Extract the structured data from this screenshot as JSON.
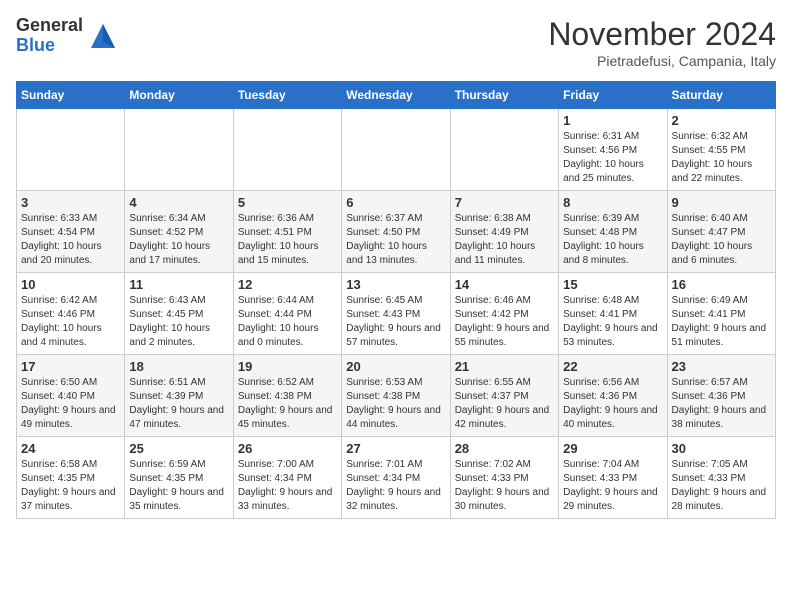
{
  "logo": {
    "general": "General",
    "blue": "Blue"
  },
  "title": "November 2024",
  "location": "Pietradefusi, Campania, Italy",
  "days_of_week": [
    "Sunday",
    "Monday",
    "Tuesday",
    "Wednesday",
    "Thursday",
    "Friday",
    "Saturday"
  ],
  "weeks": [
    [
      {
        "day": "",
        "info": ""
      },
      {
        "day": "",
        "info": ""
      },
      {
        "day": "",
        "info": ""
      },
      {
        "day": "",
        "info": ""
      },
      {
        "day": "",
        "info": ""
      },
      {
        "day": "1",
        "info": "Sunrise: 6:31 AM\nSunset: 4:56 PM\nDaylight: 10 hours and 25 minutes."
      },
      {
        "day": "2",
        "info": "Sunrise: 6:32 AM\nSunset: 4:55 PM\nDaylight: 10 hours and 22 minutes."
      }
    ],
    [
      {
        "day": "3",
        "info": "Sunrise: 6:33 AM\nSunset: 4:54 PM\nDaylight: 10 hours and 20 minutes."
      },
      {
        "day": "4",
        "info": "Sunrise: 6:34 AM\nSunset: 4:52 PM\nDaylight: 10 hours and 17 minutes."
      },
      {
        "day": "5",
        "info": "Sunrise: 6:36 AM\nSunset: 4:51 PM\nDaylight: 10 hours and 15 minutes."
      },
      {
        "day": "6",
        "info": "Sunrise: 6:37 AM\nSunset: 4:50 PM\nDaylight: 10 hours and 13 minutes."
      },
      {
        "day": "7",
        "info": "Sunrise: 6:38 AM\nSunset: 4:49 PM\nDaylight: 10 hours and 11 minutes."
      },
      {
        "day": "8",
        "info": "Sunrise: 6:39 AM\nSunset: 4:48 PM\nDaylight: 10 hours and 8 minutes."
      },
      {
        "day": "9",
        "info": "Sunrise: 6:40 AM\nSunset: 4:47 PM\nDaylight: 10 hours and 6 minutes."
      }
    ],
    [
      {
        "day": "10",
        "info": "Sunrise: 6:42 AM\nSunset: 4:46 PM\nDaylight: 10 hours and 4 minutes."
      },
      {
        "day": "11",
        "info": "Sunrise: 6:43 AM\nSunset: 4:45 PM\nDaylight: 10 hours and 2 minutes."
      },
      {
        "day": "12",
        "info": "Sunrise: 6:44 AM\nSunset: 4:44 PM\nDaylight: 10 hours and 0 minutes."
      },
      {
        "day": "13",
        "info": "Sunrise: 6:45 AM\nSunset: 4:43 PM\nDaylight: 9 hours and 57 minutes."
      },
      {
        "day": "14",
        "info": "Sunrise: 6:46 AM\nSunset: 4:42 PM\nDaylight: 9 hours and 55 minutes."
      },
      {
        "day": "15",
        "info": "Sunrise: 6:48 AM\nSunset: 4:41 PM\nDaylight: 9 hours and 53 minutes."
      },
      {
        "day": "16",
        "info": "Sunrise: 6:49 AM\nSunset: 4:41 PM\nDaylight: 9 hours and 51 minutes."
      }
    ],
    [
      {
        "day": "17",
        "info": "Sunrise: 6:50 AM\nSunset: 4:40 PM\nDaylight: 9 hours and 49 minutes."
      },
      {
        "day": "18",
        "info": "Sunrise: 6:51 AM\nSunset: 4:39 PM\nDaylight: 9 hours and 47 minutes."
      },
      {
        "day": "19",
        "info": "Sunrise: 6:52 AM\nSunset: 4:38 PM\nDaylight: 9 hours and 45 minutes."
      },
      {
        "day": "20",
        "info": "Sunrise: 6:53 AM\nSunset: 4:38 PM\nDaylight: 9 hours and 44 minutes."
      },
      {
        "day": "21",
        "info": "Sunrise: 6:55 AM\nSunset: 4:37 PM\nDaylight: 9 hours and 42 minutes."
      },
      {
        "day": "22",
        "info": "Sunrise: 6:56 AM\nSunset: 4:36 PM\nDaylight: 9 hours and 40 minutes."
      },
      {
        "day": "23",
        "info": "Sunrise: 6:57 AM\nSunset: 4:36 PM\nDaylight: 9 hours and 38 minutes."
      }
    ],
    [
      {
        "day": "24",
        "info": "Sunrise: 6:58 AM\nSunset: 4:35 PM\nDaylight: 9 hours and 37 minutes."
      },
      {
        "day": "25",
        "info": "Sunrise: 6:59 AM\nSunset: 4:35 PM\nDaylight: 9 hours and 35 minutes."
      },
      {
        "day": "26",
        "info": "Sunrise: 7:00 AM\nSunset: 4:34 PM\nDaylight: 9 hours and 33 minutes."
      },
      {
        "day": "27",
        "info": "Sunrise: 7:01 AM\nSunset: 4:34 PM\nDaylight: 9 hours and 32 minutes."
      },
      {
        "day": "28",
        "info": "Sunrise: 7:02 AM\nSunset: 4:33 PM\nDaylight: 9 hours and 30 minutes."
      },
      {
        "day": "29",
        "info": "Sunrise: 7:04 AM\nSunset: 4:33 PM\nDaylight: 9 hours and 29 minutes."
      },
      {
        "day": "30",
        "info": "Sunrise: 7:05 AM\nSunset: 4:33 PM\nDaylight: 9 hours and 28 minutes."
      }
    ]
  ]
}
